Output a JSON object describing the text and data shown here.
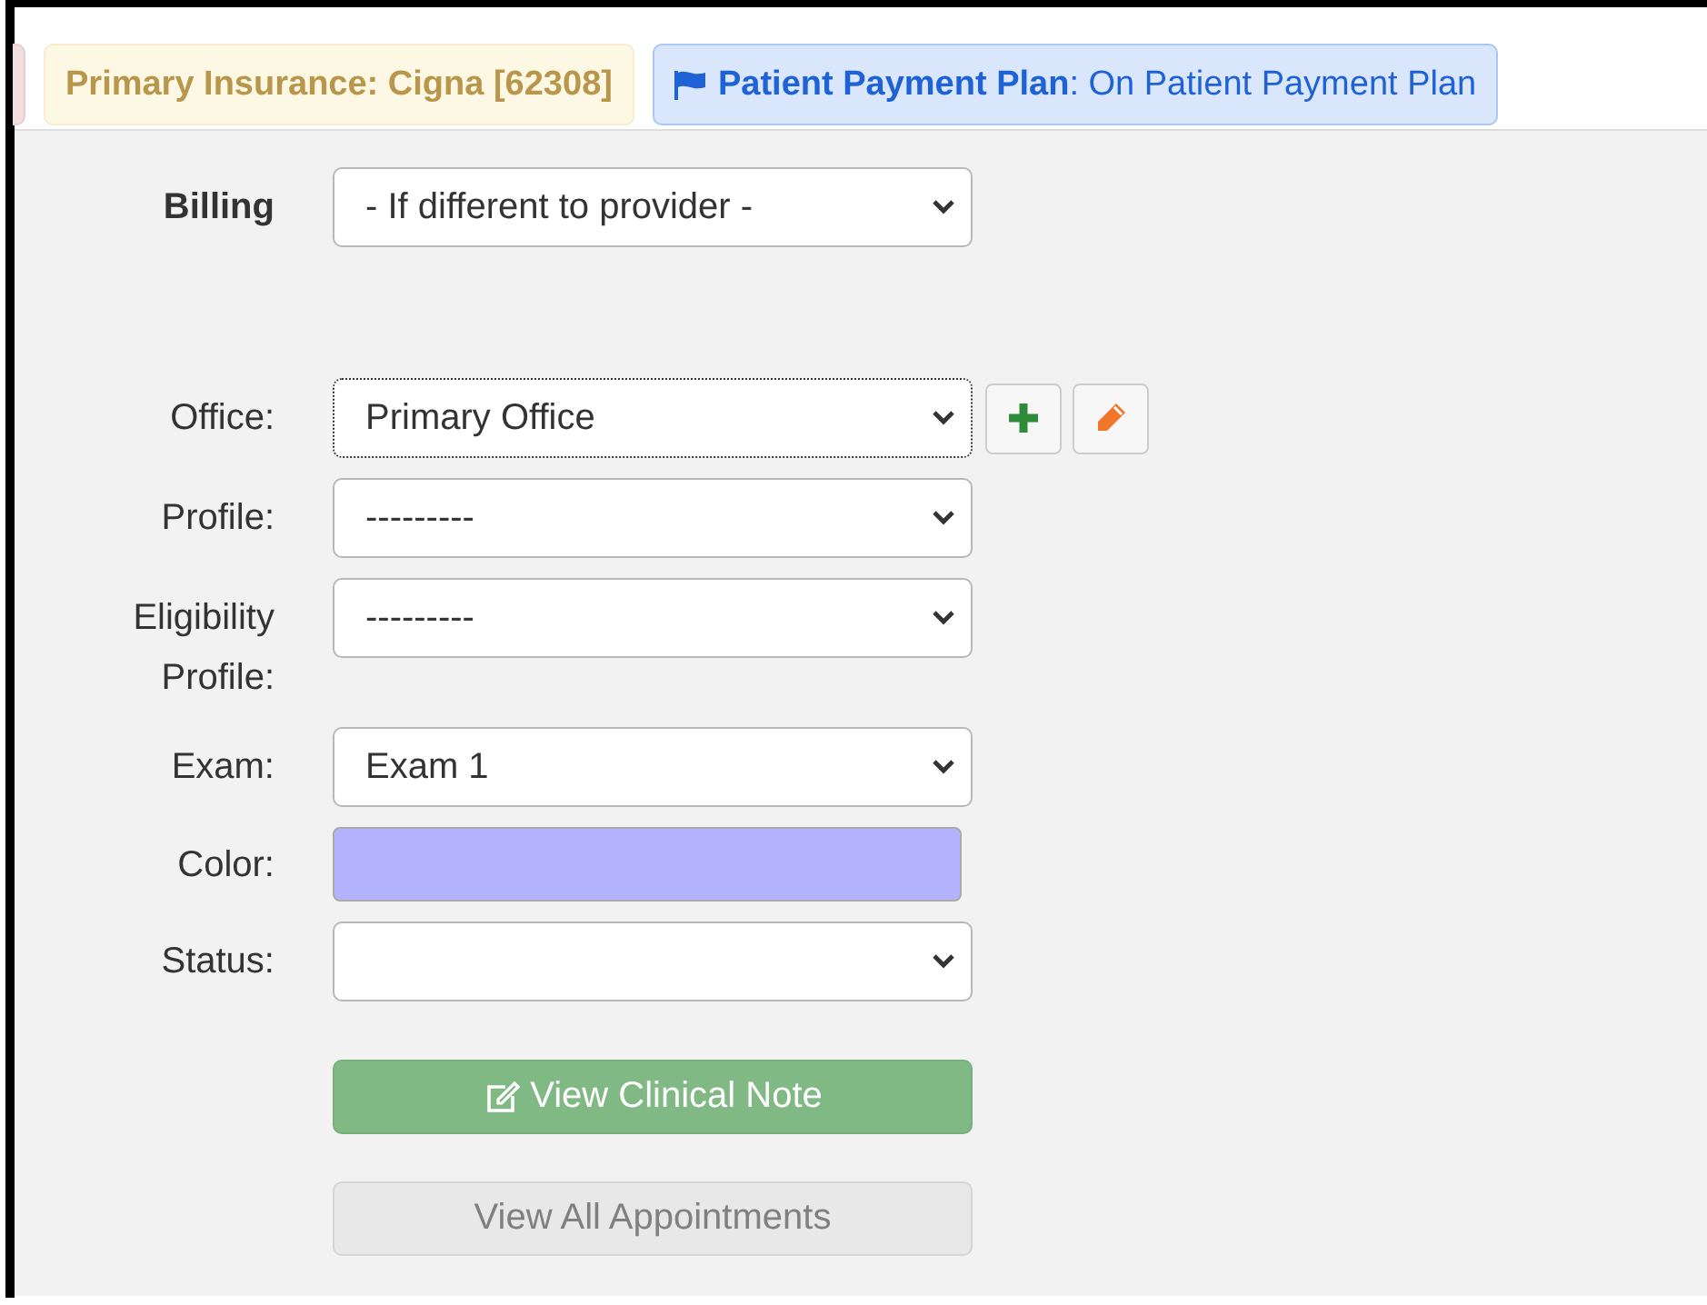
{
  "tags": [
    {
      "kind": "danger"
    },
    {
      "kind": "warning",
      "label": "Primary Insurance: Cigna [62308]"
    },
    {
      "kind": "info",
      "label": "**Patient Payment Plan**: On Patient Payment Plan"
    }
  ],
  "billing": {
    "label": "Billing",
    "value": "- If different to provider -"
  },
  "fields": [
    {
      "kind": "select",
      "label": "Office:",
      "value": "Primary Office",
      "focused": true,
      "actions": [
        {
          "kind": "add"
        },
        {
          "kind": "edit"
        }
      ]
    },
    {
      "kind": "select",
      "label": "Profile:",
      "value": "---------",
      "focused": false
    },
    {
      "kind": "select",
      "label": "Eligibility Profile:",
      "value": "---------",
      "focused": false
    },
    {
      "kind": "select",
      "label": "Exam:",
      "value": "Exam 1",
      "focused": false
    },
    {
      "kind": "color",
      "label": "Color:",
      "color": "#b3b3fd"
    },
    {
      "kind": "select",
      "label": "Status:",
      "focused": false
    }
  ],
  "buttons": [
    {
      "kind": "success",
      "label": "View Clinical Note",
      "disabled": false
    },
    {
      "kind": "default",
      "label": "View All Appointments",
      "disabled": true
    }
  ]
}
